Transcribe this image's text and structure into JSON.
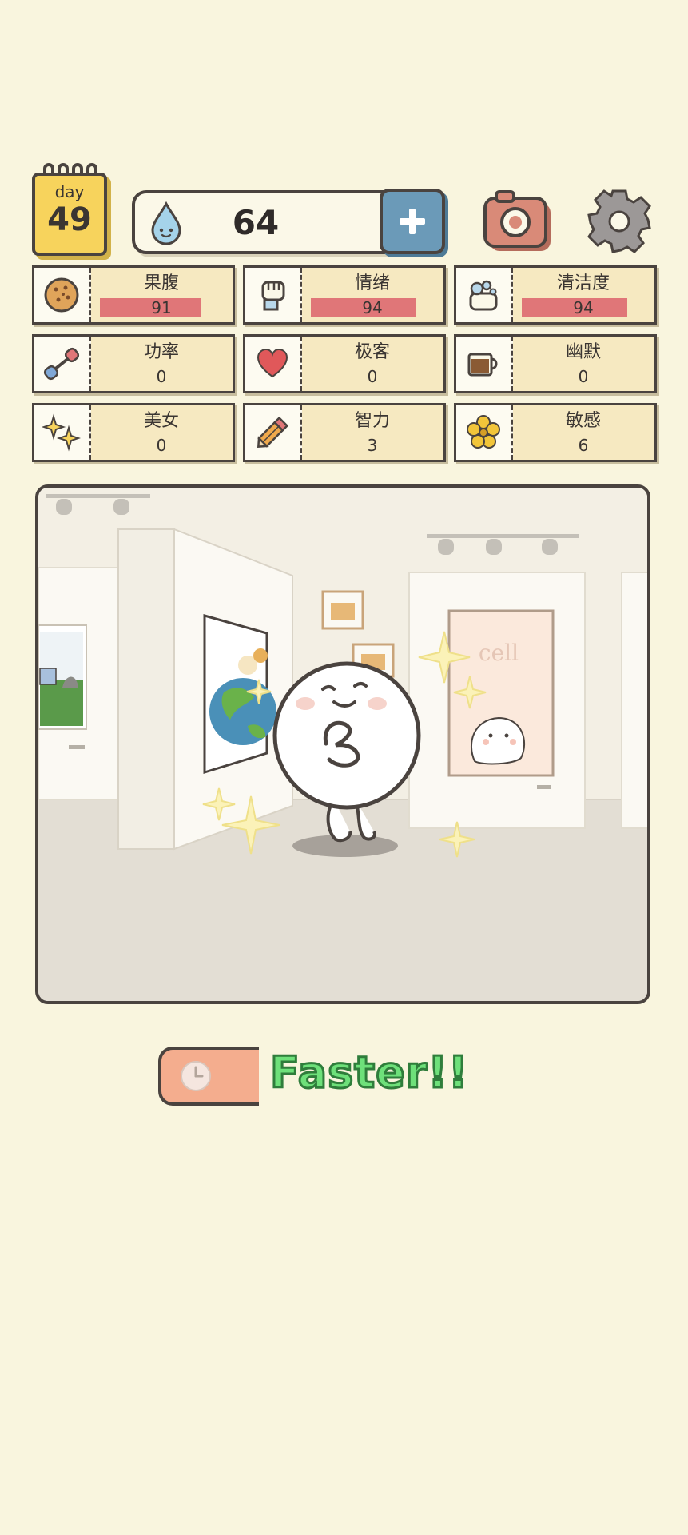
{
  "header": {
    "day_label": "day",
    "day_number": "49",
    "currency_amount": "64",
    "icons": {
      "calendar": "calendar-icon",
      "currency": "water-drop-icon",
      "add": "plus-icon",
      "camera": "camera-icon",
      "settings": "gear-icon"
    }
  },
  "stats": [
    {
      "label": "果腹",
      "value": "91",
      "bar": 0.91,
      "icon": "cookie-icon"
    },
    {
      "label": "情绪",
      "value": "94",
      "bar": 0.94,
      "icon": "fist-icon"
    },
    {
      "label": "清洁度",
      "value": "94",
      "bar": 0.94,
      "icon": "soap-icon"
    },
    {
      "label": "功率",
      "value": "0",
      "icon": "dumbbell-icon"
    },
    {
      "label": "极客",
      "value": "0",
      "icon": "heart-icon"
    },
    {
      "label": "幽默",
      "value": "0",
      "icon": "coffee-cup-icon"
    },
    {
      "label": "美女",
      "value": "0",
      "icon": "sparkle-icon"
    },
    {
      "label": "智力",
      "value": "3",
      "icon": "pencil-icon"
    },
    {
      "label": "敏感",
      "value": "6",
      "icon": "flower-icon"
    }
  ],
  "scene": {
    "poster_text": "cell"
  },
  "footer": {
    "timer_icon": "clock-icon",
    "speed_label": "Faster!!"
  },
  "colors": {
    "background": "#f9f5de",
    "stat_bar": "#e07678",
    "stat_card": "#f6e9c1",
    "plus_button": "#6b9ab8",
    "camera": "#d98a78",
    "timer_button": "#f4ad8e",
    "faster_text": "#6ee07a",
    "calendar": "#f7d35c"
  }
}
